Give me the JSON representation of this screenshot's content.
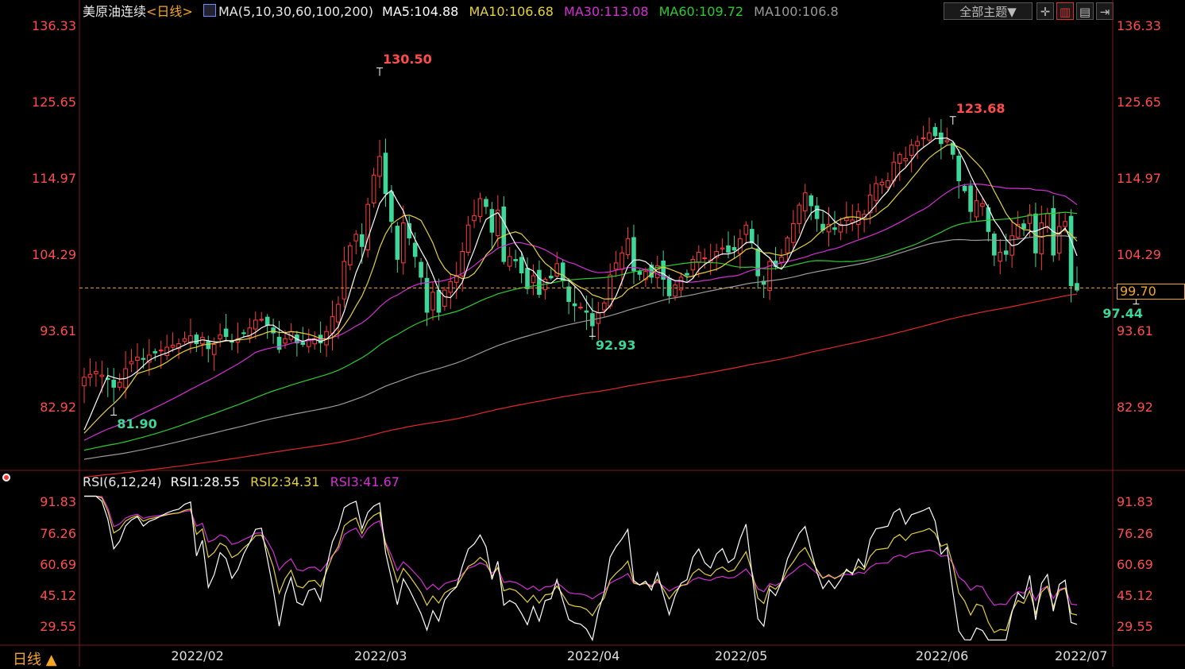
{
  "header": {
    "instrument": "美原油连续",
    "period": "<日线>",
    "ma_label": "MA(5,10,30,60,100,200)",
    "ma5": "MA5:104.88",
    "ma10": "MA10:106.68",
    "ma30": "MA30:113.08",
    "ma60": "MA60:109.72",
    "ma100": "MA100:106.8",
    "theme_button": "全部主题▼"
  },
  "colors": {
    "up": "#ff3b3b",
    "down": "#3fd69a",
    "ma5": "#ffffff",
    "ma10": "#e6d23a",
    "ma30": "#d52fd5",
    "ma60": "#2ecc2e",
    "ma100": "#9a9a9a",
    "ma200": "#e02828",
    "axis_red": "#ff4d4d",
    "current": "#f5a623"
  },
  "rsi_header": {
    "label": "RSI(6,12,24)",
    "rsi1": "RSI1:28.55",
    "rsi2": "RSI2:34.31",
    "rsi3": "RSI3:41.67"
  },
  "footer": {
    "period_label": "日线 ▲"
  },
  "chart_data": [
    {
      "type": "candlestick",
      "title": "美原油连续",
      "ylim": [
        74.5,
        136.33
      ],
      "y_ticks": [
        "136.33",
        "125.65",
        "114.97",
        "104.29",
        "93.61",
        "82.92"
      ],
      "x_ticks": [
        "2022/02",
        "2022/03",
        "2022/04",
        "2022/05",
        "2022/06",
        "2022/07"
      ],
      "current_price": "99.70",
      "annotations": [
        {
          "label": "130.50",
          "kind": "high",
          "day": 50
        },
        {
          "label": "81.90",
          "kind": "low",
          "day": 5
        },
        {
          "label": "92.93",
          "kind": "low",
          "day": 86
        },
        {
          "label": "123.68",
          "kind": "high",
          "day": 147
        },
        {
          "label": "97.44",
          "kind": "low",
          "day": 178
        }
      ],
      "closes": [
        87.2,
        87.6,
        88.0,
        87.5,
        86.9,
        85.8,
        86.5,
        88.4,
        89.4,
        90.0,
        89.7,
        90.3,
        90.6,
        91.0,
        91.4,
        91.7,
        91.9,
        92.6,
        93.0,
        91.9,
        92.8,
        91.2,
        91.8,
        93.1,
        92.9,
        92.2,
        92.6,
        93.4,
        94.1,
        95.2,
        95.3,
        94.5,
        93.4,
        91.1,
        92.6,
        93.6,
        92.0,
        91.8,
        92.5,
        92.6,
        92.0,
        93.6,
        95.7,
        97.4,
        103.4,
        105.6,
        107.2,
        105.5,
        111.4,
        115.5,
        118.1,
        112.9,
        109.0,
        103.7,
        108.8,
        106.7,
        104.1,
        101.2,
        96.3,
        99.1,
        96.3,
        99.4,
        100.6,
        101.4,
        104.8,
        108.5,
        109.8,
        112.2,
        111.1,
        107.5,
        110.6,
        103.4,
        104.1,
        103.5,
        101.8,
        99.6,
        101.4,
        98.8,
        100.9,
        101.1,
        103.1,
        100.7,
        97.8,
        97.2,
        97.0,
        96.3,
        94.4,
        96.2,
        97.6,
        101.5,
        103.2,
        104.6,
        106.6,
        102.1,
        101.6,
        102.0,
        101.2,
        102.8,
        100.9,
        98.6,
        100.1,
        101.2,
        101.5,
        103.7,
        104.7,
        103.9,
        103.6,
        104.8,
        105.3,
        104.7,
        105.0,
        106.6,
        108.5,
        106.0,
        101.4,
        100.2,
        103.4,
        102.7,
        104.0,
        106.7,
        108.7,
        111.3,
        113.0,
        111.2,
        109.4,
        107.8,
        108.6,
        107.9,
        108.6,
        109.5,
        109.2,
        110.4,
        110.0,
        112.7,
        114.3,
        114.5,
        114.7,
        117.3,
        118.4,
        117.8,
        119.7,
        120.2,
        120.7,
        121.4,
        121.0,
        119.9,
        120.4,
        118.4,
        114.7,
        113.3,
        110.4,
        111.9,
        111.5,
        107.6,
        104.3,
        104.7,
        104.4,
        107.0,
        108.6,
        108.0,
        110.0,
        104.6,
        108.8,
        110.1,
        104.3,
        108.3,
        109.0,
        100.0,
        99.4
      ],
      "open_prefix_note": "",
      "ma_lines_series": [
        "MA5",
        "MA10",
        "MA30",
        "MA60",
        "MA100",
        "MA200"
      ]
    },
    {
      "type": "line",
      "title": "RSI(6,12,24)",
      "ylim": [
        22,
        96
      ],
      "y_ticks": [
        "91.83",
        "76.26",
        "60.69",
        "45.12",
        "29.55"
      ],
      "series": [
        {
          "name": "RSI1",
          "last": 28.55
        },
        {
          "name": "RSI2",
          "last": 34.31
        },
        {
          "name": "RSI3",
          "last": 41.67
        }
      ]
    }
  ]
}
